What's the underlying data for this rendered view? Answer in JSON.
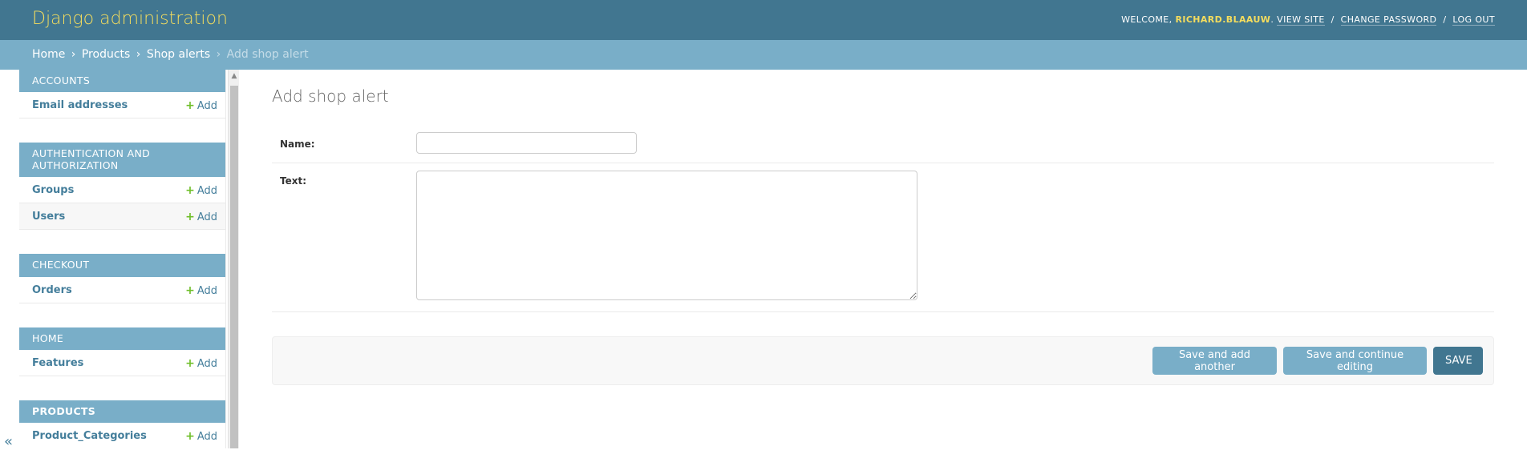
{
  "header": {
    "branding": "Django administration",
    "welcome": "Welcome,",
    "username": "richard.blaauw",
    "view_site": "View site",
    "change_password": "Change password",
    "log_out": "Log out",
    "separator": "/"
  },
  "breadcrumbs": {
    "home": "Home",
    "products": "Products",
    "shop_alerts": "Shop alerts",
    "current": "Add shop alert",
    "separator": "›"
  },
  "sidebar": {
    "add_label": "Add",
    "collapse_icon": "«",
    "modules": [
      {
        "caption": "Accounts",
        "models": [
          "Email addresses"
        ]
      },
      {
        "caption": "Authentication and Authorization",
        "models": [
          "Groups",
          "Users"
        ]
      },
      {
        "caption": "Checkout",
        "models": [
          "Orders"
        ]
      },
      {
        "caption": "Home",
        "models": [
          "Features"
        ]
      },
      {
        "caption": "Products",
        "models": [
          "Product_Categories"
        ]
      }
    ]
  },
  "content": {
    "title": "Add shop alert",
    "fields": {
      "name_label": "Name:",
      "name_value": "",
      "text_label": "Text:",
      "text_value": ""
    },
    "buttons": {
      "save_add_another": "Save and add another",
      "save_continue": "Save and continue editing",
      "save": "Save"
    }
  },
  "colors": {
    "header_bg": "#417690",
    "breadcrumb_bg": "#79aec8",
    "brand_yellow": "#f5dd5d",
    "link_blue": "#447e9b",
    "add_green": "#70bf2b"
  }
}
